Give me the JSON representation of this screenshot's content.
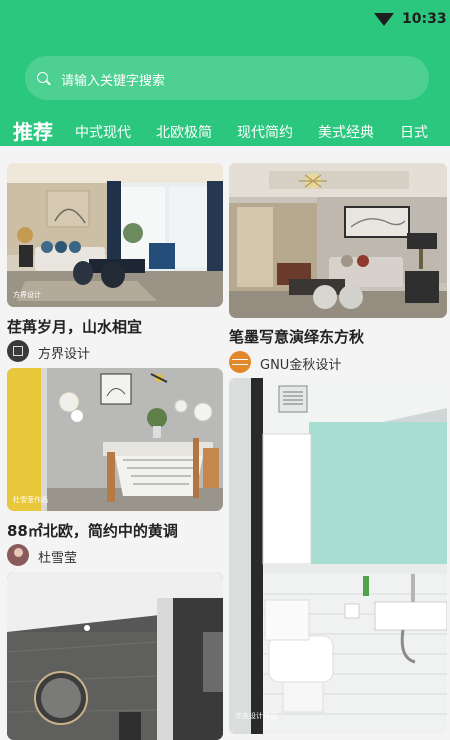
{
  "status_bar": {
    "time": "10:33"
  },
  "search": {
    "placeholder": "请输入关键字搜索"
  },
  "tabs": [
    {
      "label": "推荐"
    },
    {
      "label": "中式现代"
    },
    {
      "label": "北欧极简"
    },
    {
      "label": "现代简约"
    },
    {
      "label": "美式经典"
    },
    {
      "label": "日式"
    }
  ],
  "feed": [
    {
      "title": "荏苒岁月，山水相宜",
      "author": "方界设计",
      "image_watermark": "方界设计"
    },
    {
      "title": "笔墨写意演绎东方秋",
      "author": "GNU金秋设计",
      "avatar_logo": "金秋"
    },
    {
      "title": "88㎡北欧，简约中的黄调",
      "author": "杜雪莹",
      "image_watermark": "杜雪莹作品"
    },
    {
      "title": "",
      "author": "",
      "image_watermark": "齐衣设计作品"
    },
    {
      "title": "",
      "author": ""
    }
  ],
  "colors": {
    "brand": "#2cc77e",
    "background": "#f4f4f4"
  }
}
